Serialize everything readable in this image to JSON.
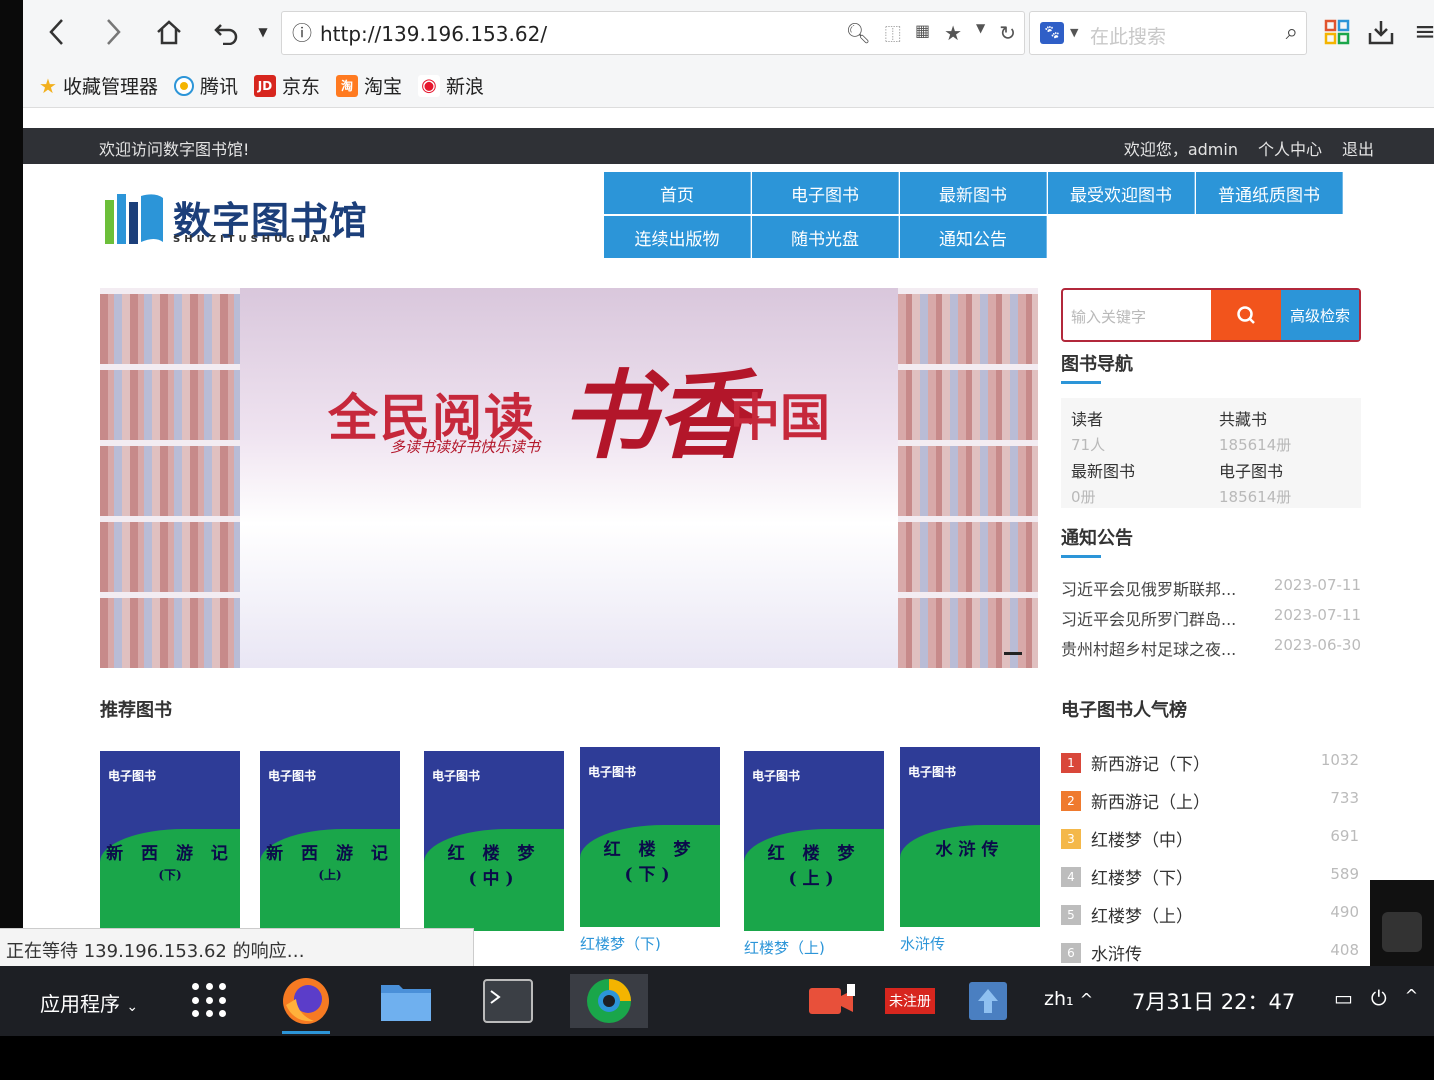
{
  "browser": {
    "url": "http://139.196.153.62/",
    "search_placeholder": "在此搜索",
    "bookmarks": [
      {
        "label": "收藏管理器",
        "icon": "star-icon"
      },
      {
        "label": "腾讯",
        "icon": "tencent-icon"
      },
      {
        "label": "京东",
        "icon": "jd-icon"
      },
      {
        "label": "淘宝",
        "icon": "taobao-icon"
      },
      {
        "label": "新浪",
        "icon": "weibo-icon"
      }
    ],
    "status_text": "正在等待 139.196.153.62 的响应…"
  },
  "site": {
    "welcome": "欢迎访问数字图书馆!",
    "user_greeting": "欢迎您，admin",
    "user_center": "个人中心",
    "logout": "退出",
    "logo_cn": "数字图书馆",
    "logo_py": "SHUZITUSHUGUAN",
    "nav": [
      "首页",
      "电子图书",
      "最新图书",
      "最受欢迎图书",
      "普通纸质图书",
      "连续出版物",
      "随书光盘",
      "通知公告"
    ],
    "banner": {
      "slogan_left": "全民阅读",
      "slogan_brush": "书香",
      "slogan_right": "中国",
      "sub": "多读书读好书快乐读书"
    },
    "search": {
      "placeholder": "输入关键字",
      "advanced": "高级检索"
    },
    "book_nav": {
      "title": "图书导航",
      "stats": [
        {
          "label": "读者",
          "value": "71人"
        },
        {
          "label": "共藏书",
          "value": "185614册"
        },
        {
          "label": "最新图书",
          "value": "0册"
        },
        {
          "label": "电子图书",
          "value": "185614册"
        }
      ]
    },
    "notices": {
      "title": "通知公告",
      "items": [
        {
          "title": "习近平会见俄罗斯联邦...",
          "date": "2023-07-11"
        },
        {
          "title": "习近平会见所罗门群岛...",
          "date": "2023-07-11"
        },
        {
          "title": "贵州村超乡村足球之夜...",
          "date": "2023-06-30"
        }
      ]
    },
    "recommended": {
      "title": "推荐图书",
      "books": [
        {
          "cover_title": "新 西 游 记",
          "cover_sub": "(下)",
          "caption": ""
        },
        {
          "cover_title": "新 西 游 记",
          "cover_sub": "(上)",
          "caption": ")"
        },
        {
          "cover_title": "红 楼 梦",
          "cover_sub": "(中)",
          "caption": ")"
        },
        {
          "cover_title": "红 楼 梦",
          "cover_sub": "(下)",
          "caption": "红楼梦（下)"
        },
        {
          "cover_title": "红 楼 梦",
          "cover_sub": "(上)",
          "caption": "红楼梦（上)"
        },
        {
          "cover_title": "水浒传",
          "cover_sub": "",
          "caption": "水浒传"
        }
      ],
      "cover_header": "电子图书"
    },
    "ranking": {
      "title": "电子图书人气榜",
      "items": [
        {
          "rank": "1",
          "name": "新西游记（下）",
          "count": "1032",
          "color": "#d9473a"
        },
        {
          "rank": "2",
          "name": "新西游记（上）",
          "count": "733",
          "color": "#ef7a2e"
        },
        {
          "rank": "3",
          "name": "红楼梦（中）",
          "count": "691",
          "color": "#f4b84a"
        },
        {
          "rank": "4",
          "name": "红楼梦（下）",
          "count": "589",
          "color": "#bdbdbd"
        },
        {
          "rank": "5",
          "name": "红楼梦（上）",
          "count": "490",
          "color": "#bdbdbd"
        },
        {
          "rank": "6",
          "name": "水浒传",
          "count": "408",
          "color": "#bdbdbd"
        }
      ]
    }
  },
  "taskbar": {
    "apps_label": "应用程序",
    "lang": "zh₁",
    "clock": "7月31日 22：47",
    "unregistered": "未注册"
  },
  "colors": {
    "nav_blue": "#2c95d8",
    "search_orange": "#f2541c",
    "topbar": "#2f3136"
  }
}
